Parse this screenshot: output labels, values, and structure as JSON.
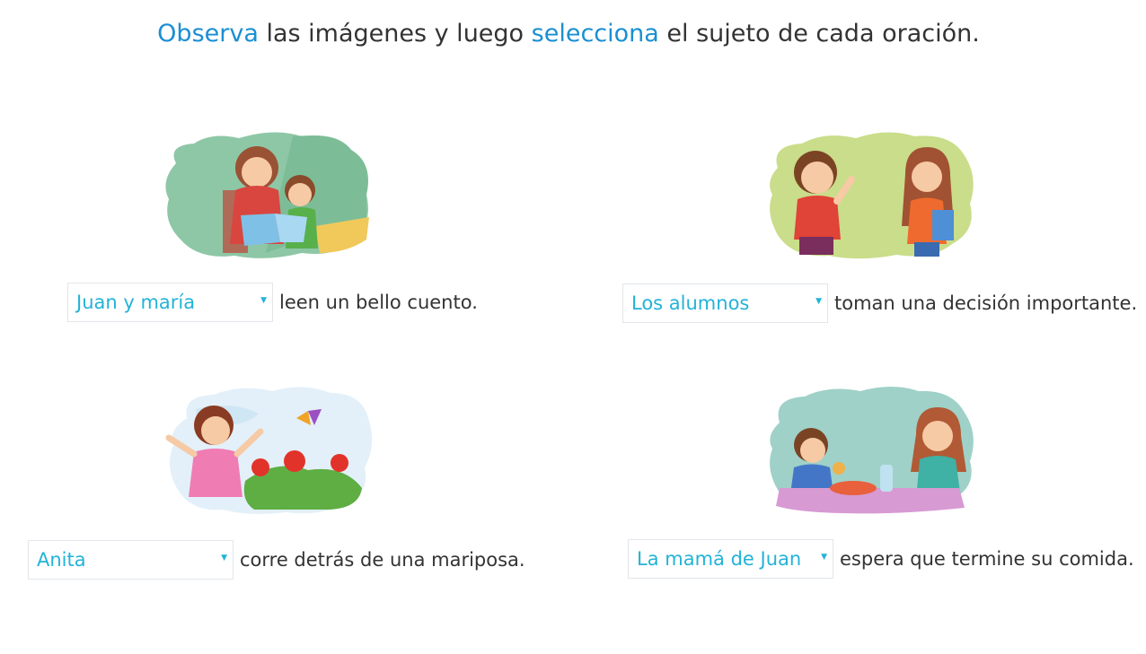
{
  "instruction": {
    "part1": "Observa",
    "part2": " las imágenes y luego ",
    "part3": "selecciona",
    "part4": " el sujeto de cada oración."
  },
  "colors": {
    "accent": "#1b8fd2",
    "select_text": "#22b3d8",
    "body_text": "#333333",
    "select_border": "#e2e6ea"
  },
  "exercises": [
    {
      "image_icon": "mother-reading-book-to-child-image",
      "selected": "Juan y maría",
      "rest": "leen un bello cuento."
    },
    {
      "image_icon": "two-children-talking-image",
      "selected": "Los alumnos",
      "rest": "toman una decisión importante."
    },
    {
      "image_icon": "girl-with-flowers-and-butterfly-image",
      "selected": "Anita",
      "rest": "corre detrás de una mariposa."
    },
    {
      "image_icon": "mother-and-son-at-table-image",
      "selected": "La mamá de Juan",
      "rest": "espera que termine su comida."
    }
  ]
}
